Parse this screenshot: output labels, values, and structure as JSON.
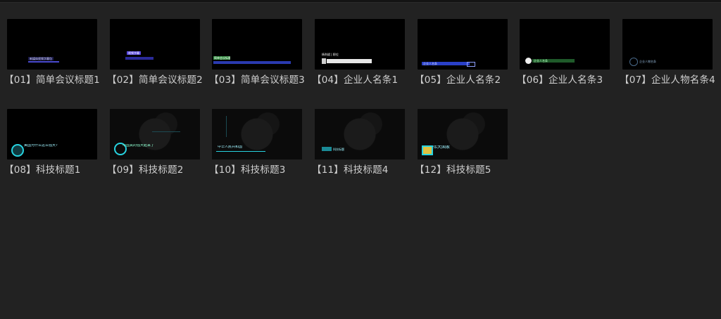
{
  "items": [
    {
      "label": "【01】简单会议标题1",
      "thumb_text": "新媒体视频字幕包"
    },
    {
      "label": "【02】简单会议标题2",
      "thumb_text": "视频字幕"
    },
    {
      "label": "【03】简单会议标题3",
      "thumb_text": "简单会议标题"
    },
    {
      "label": "【04】企业人名条1",
      "thumb_text": "杨利斌 | 职位"
    },
    {
      "label": "【05】企业人名条2",
      "thumb_text": "企业人名条"
    },
    {
      "label": "【06】企业人名条3",
      "thumb_text": "企业人名条"
    },
    {
      "label": "【07】企业人物名条4",
      "thumb_text": "企业人物名条"
    },
    {
      "label": "【08】科技标题1",
      "thumb_text": "美国为什么这么强大?"
    },
    {
      "label": "【09】科技标题2",
      "thumb_text": "中国真的强大起来了"
    },
    {
      "label": "【10】科技标题3",
      "thumb_text": "中华人民共和国"
    },
    {
      "label": "【11】科技标题4",
      "thumb_text": "科技标题"
    },
    {
      "label": "【12】科技标题5",
      "thumb_text": "伟大国家"
    }
  ],
  "colors": {
    "background": "#222222",
    "label_text": "#cfcfcf",
    "tech_accent": "#27d3e0"
  }
}
